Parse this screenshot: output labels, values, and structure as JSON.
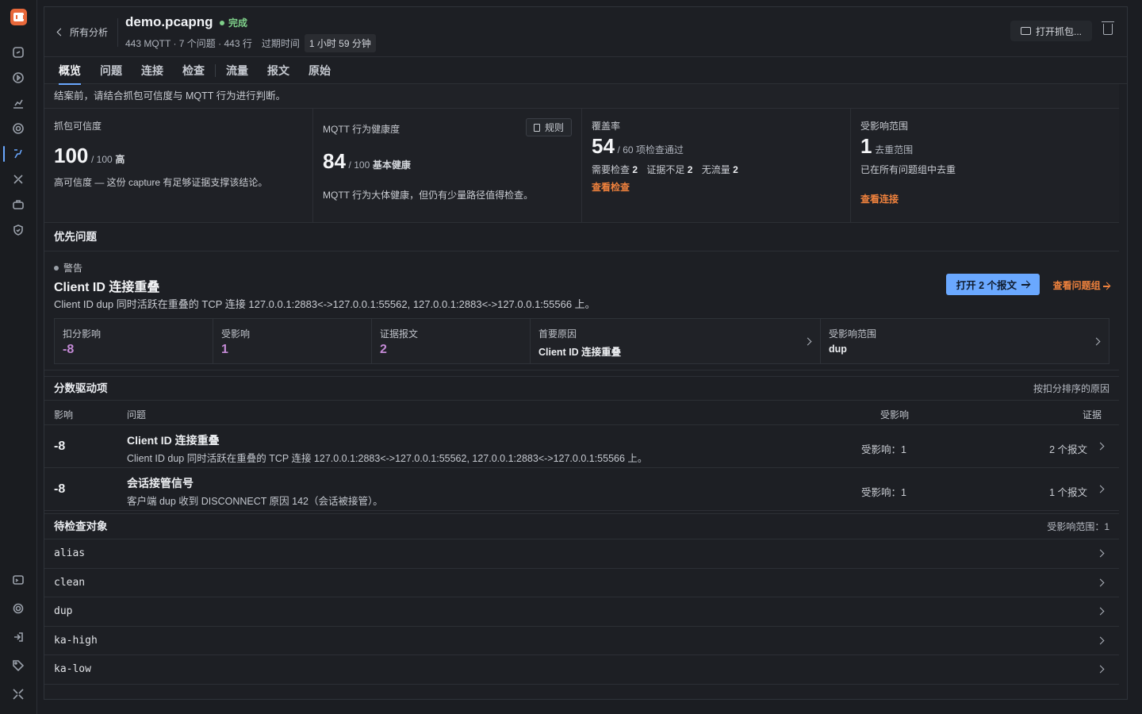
{
  "header": {
    "back_label": "所有分析",
    "title": "demo.pcapng",
    "status": "完成",
    "meta": "443 MQTT · 7 个问题 · 443 行",
    "expire_label": "过期时间",
    "expire_value": "1 小时 59 分钟",
    "open_button": "打开抓包..."
  },
  "tabs": [
    "概览",
    "问题",
    "连接",
    "检查",
    "流量",
    "报文",
    "原始"
  ],
  "note": "结案前，请结合抓包可信度与 MQTT 行为进行判断。",
  "cards": {
    "confidence": {
      "label": "抓包可信度",
      "score": "100",
      "total": "/ 100",
      "grade": "高",
      "text": "高可信度 — 这份 capture 有足够证据支撑该结论。"
    },
    "health": {
      "label": "MQTT 行为健康度",
      "rules_button": "规则",
      "score": "84",
      "total": "/ 100",
      "grade": "基本健康",
      "text": "MQTT 行为大体健康，但仍有少量路径值得检查。"
    },
    "coverage": {
      "label": "覆盖率",
      "score": "54",
      "suffix": "/ 60 项检查通过",
      "need_label": "需要检查",
      "need": "2",
      "insuff_label": "证据不足",
      "insuff": "2",
      "notraffic_label": "无流量",
      "notraffic": "2",
      "link": "查看检查"
    },
    "scope": {
      "label": "受影响范围",
      "score": "1",
      "suffix": "去重范围",
      "text": "已在所有问题组中去重",
      "link": "查看连接"
    }
  },
  "priority": {
    "heading": "优先问题",
    "severity": "警告",
    "title": "Client ID 连接重叠",
    "desc": "Client ID dup 同时活跃在重叠的 TCP 连接 127.0.0.1:2883<->127.0.0.1:55562, 127.0.0.1:2883<->127.0.0.1:55566 上。",
    "open_button": "打开 2 个报文",
    "group_link": "查看问题组",
    "stats": [
      {
        "label": "扣分影响",
        "value": "-8"
      },
      {
        "label": "受影响",
        "value": "1"
      },
      {
        "label": "证据报文",
        "value": "2"
      },
      {
        "label": "首要原因",
        "value": "Client ID 连接重叠"
      },
      {
        "label": "受影响范围",
        "value": "dup"
      }
    ]
  },
  "drivers": {
    "heading": "分数驱动项",
    "right": "按扣分排序的原因",
    "columns": {
      "impact": "影响",
      "issue": "问题",
      "affected": "受影响",
      "evidence": "证据"
    },
    "rows": [
      {
        "impact": "-8",
        "title": "Client ID 连接重叠",
        "desc": "Client ID dup 同时活跃在重叠的 TCP 连接 127.0.0.1:2883<->127.0.0.1:55562, 127.0.0.1:2883<->127.0.0.1:55566 上。",
        "affected": "受影响：1",
        "evidence": "2 个报文"
      },
      {
        "impact": "-8",
        "title": "会话接管信号",
        "desc": "客户端 dup 收到 DISCONNECT 原因 142（会话被接管）。",
        "affected": "受影响：1",
        "evidence": "1 个报文"
      }
    ]
  },
  "pending": {
    "heading": "待检查对象",
    "right": "受影响范围：1",
    "items": [
      "alias",
      "clean",
      "dup",
      "ka-high",
      "ka-low"
    ]
  },
  "icons": [
    "logo-icon",
    "link-icon",
    "play-icon",
    "chart-icon",
    "target-icon",
    "flow-icon",
    "tools-icon",
    "case-icon",
    "shield-icon",
    "terminal-icon",
    "gear-icon",
    "login-icon",
    "tag-icon",
    "collapse-icon"
  ],
  "colors": {
    "accent": "#6aa8ff",
    "link": "#f0823d",
    "success": "#7fd08a",
    "impact": "#c48ad6"
  }
}
